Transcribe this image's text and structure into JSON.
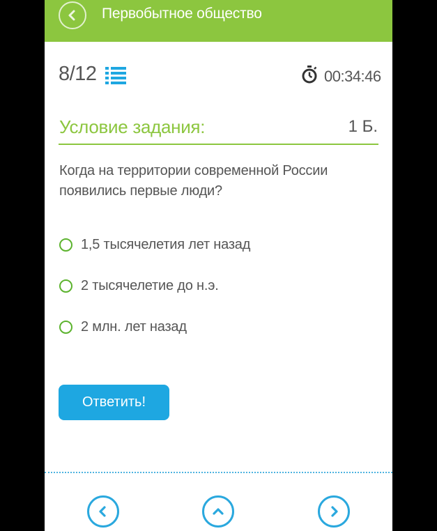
{
  "header": {
    "title": "Первобытное общество",
    "back_icon": "chevron-left-icon"
  },
  "status": {
    "counter": "8/12",
    "timer": "00:34:46",
    "list_icon": "list-icon",
    "timer_icon": "stopwatch-icon"
  },
  "task": {
    "section_title": "Условие задания:",
    "points": "1 Б.",
    "question": "Когда на территории современной России появились первые люди?",
    "options": [
      {
        "label": "1,5 тысячелетия лет назад"
      },
      {
        "label": "2 тысячелетие до н.э."
      },
      {
        "label": "2 млн. лет назад"
      }
    ],
    "submit_label": "Ответить!"
  },
  "bottom_nav": {
    "prev_icon": "chevron-left-icon",
    "up_icon": "chevron-up-icon",
    "next_icon": "chevron-right-icon"
  },
  "colors": {
    "brand_green": "#8cc63f",
    "radio_green": "#5cb32e",
    "accent_blue": "#1ea7e1",
    "text_gray": "#555555"
  }
}
